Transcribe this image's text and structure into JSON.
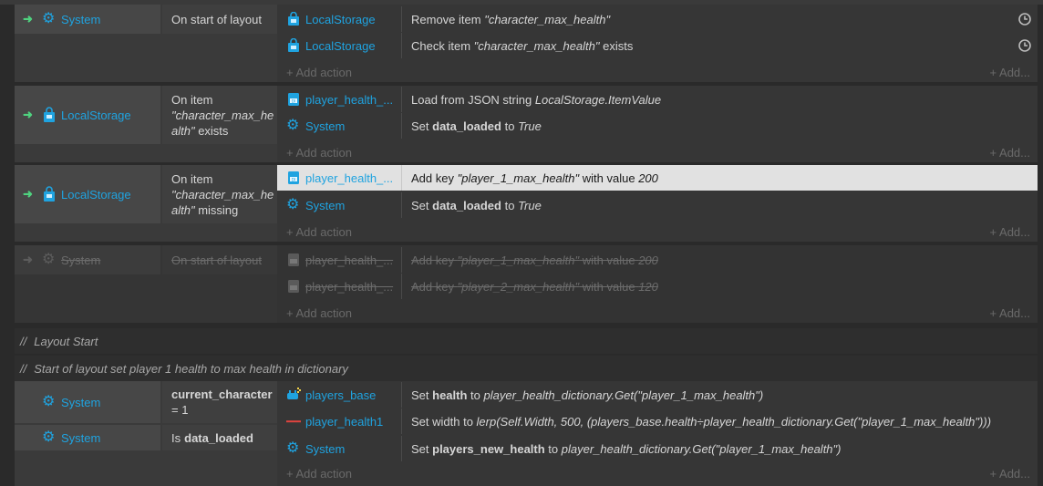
{
  "common": {
    "add_action": "+ Add action",
    "add_more": "+ Add..."
  },
  "event1": {
    "cond_obj": "System",
    "cond_text": "On start of layout",
    "actions": [
      {
        "obj": "LocalStorage",
        "pre": "Remove item ",
        "it": "\"character_max_health\"",
        "post": ""
      },
      {
        "obj": "LocalStorage",
        "pre": "Check item ",
        "it": "\"character_max_health\"",
        "post": " exists"
      }
    ]
  },
  "event2": {
    "cond_obj": "LocalStorage",
    "cond_l1": "On item",
    "cond_l2": "\"character_max_he",
    "cond_l3a": "alth\"",
    "cond_l3b": " exists",
    "actions": [
      {
        "obj": "player_health_...",
        "pre": "Load from JSON string ",
        "it": "LocalStorage.ItemValue"
      },
      {
        "obj": "System",
        "pre": "Set ",
        "b": "data_loaded",
        "mid": " to ",
        "it": "True"
      }
    ]
  },
  "event3": {
    "cond_obj": "LocalStorage",
    "cond_l1": "On item",
    "cond_l2": "\"character_max_he",
    "cond_l3a": "alth\"",
    "cond_l3b": " missing",
    "actions": [
      {
        "obj": "player_health_...",
        "pre": "Add key ",
        "it": "\"player_1_max_health\"",
        "mid": " with value ",
        "it2": "200"
      },
      {
        "obj": "System",
        "pre": "Set ",
        "b": "data_loaded",
        "mid": " to ",
        "it": "True"
      }
    ]
  },
  "event4": {
    "cond_obj": "System",
    "cond_text": "On start of layout",
    "actions": [
      {
        "obj": "player_health_...",
        "pre": "Add key ",
        "it": "\"player_1_max_health\"",
        "mid": " with value ",
        "it2": "200"
      },
      {
        "obj": "player_health_...",
        "pre": "Add key ",
        "it": "\"player_2_max_health\"",
        "mid": " with value ",
        "it2": "120"
      }
    ]
  },
  "comments": {
    "slash": "//",
    "c1": "Layout Start",
    "c2": "Start of layout set player 1 health to max health in dictionary"
  },
  "event5": {
    "cond1_obj": "System",
    "cond1_b": "current_character",
    "cond1_rest": "= 1",
    "cond2_obj": "System",
    "cond2_pre": "Is ",
    "cond2_b": "data_loaded",
    "actions": [
      {
        "obj": "players_base",
        "pre": "Set ",
        "b": "health",
        "mid": " to ",
        "it": "player_health_dictionary.Get(\"player_1_max_health\")"
      },
      {
        "obj": "player_health1",
        "pre": "Set width to ",
        "it": "lerp(Self.Width, 500, (players_base.health÷player_health_dictionary.Get(\"player_1_max_health\")))"
      },
      {
        "obj": "System",
        "pre": "Set ",
        "b": "players_new_health",
        "mid": " to ",
        "it": "player_health_dictionary.Get(\"player_1_max_health\")"
      }
    ]
  },
  "icons": {
    "gear": "gear-icon",
    "local_storage": "local-storage-icon",
    "dictionary": "dictionary-icon",
    "sprite": "sprite-icon",
    "bar": "progress-bar-icon",
    "clock": "async-clock-icon"
  },
  "colors": {
    "accent": "#1fa3e0",
    "trigger_arrow": "#4fd27f",
    "selected_row": "#e1e1e1"
  }
}
